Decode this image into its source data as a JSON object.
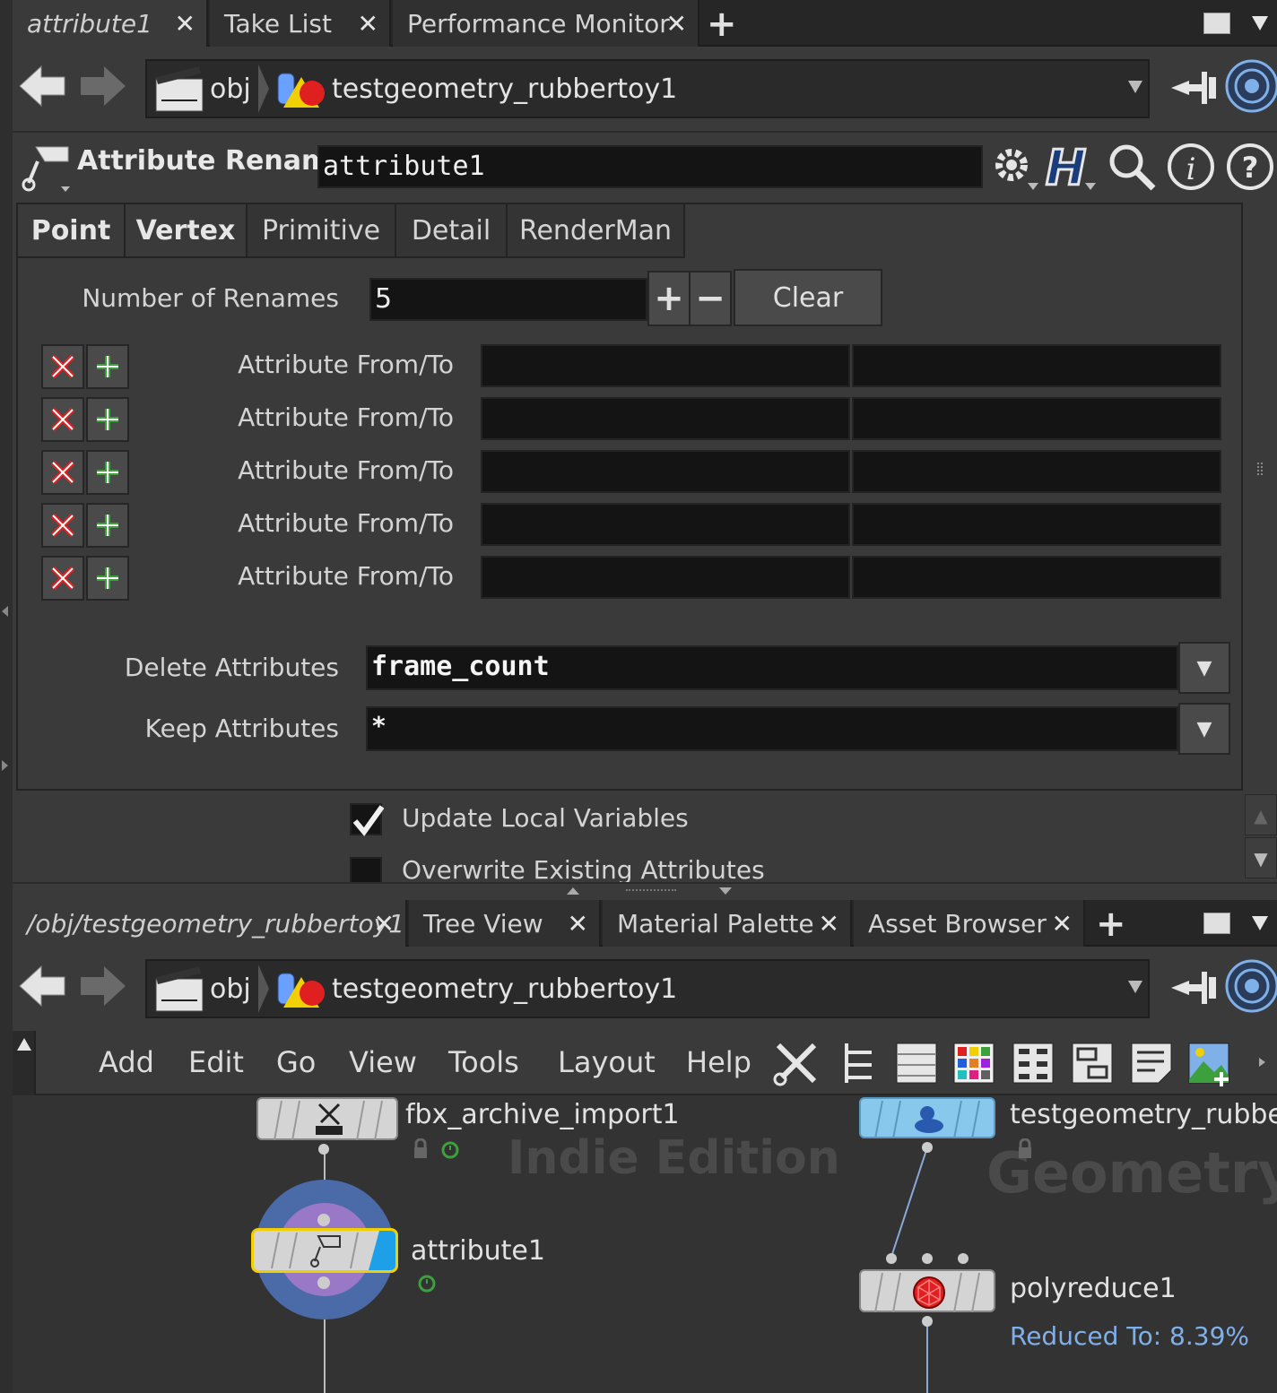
{
  "top_tabs": [
    {
      "label": "attribute1"
    },
    {
      "label": "Take List"
    },
    {
      "label": "Performance Monitor"
    }
  ],
  "top_path": {
    "root": "obj",
    "node": "testgeometry_rubbertoy1"
  },
  "param_header": {
    "node_type": "Attribute Rename",
    "node_name": "attribute1"
  },
  "param_tabs": [
    "Point",
    "Vertex",
    "Primitive",
    "Detail",
    "RenderMan"
  ],
  "params": {
    "num_renames_label": "Number of Renames",
    "num_renames_value": "5",
    "clear_label": "Clear",
    "rename_rows": [
      {
        "label": "Attribute From/To",
        "from": "",
        "to": ""
      },
      {
        "label": "Attribute From/To",
        "from": "",
        "to": ""
      },
      {
        "label": "Attribute From/To",
        "from": "",
        "to": ""
      },
      {
        "label": "Attribute From/To",
        "from": "",
        "to": ""
      },
      {
        "label": "Attribute From/To",
        "from": "",
        "to": ""
      }
    ],
    "delete_label": "Delete Attributes",
    "delete_value": "frame_count",
    "keep_label": "Keep Attributes",
    "keep_value": "*",
    "update_local_label": "Update Local Variables",
    "update_local_checked": true,
    "overwrite_label": "Overwrite Existing Attributes",
    "overwrite_checked": false
  },
  "bottom_tabs": [
    {
      "label": "/obj/testgeometry_rubbertoy1"
    },
    {
      "label": "Tree View"
    },
    {
      "label": "Material Palette"
    },
    {
      "label": "Asset Browser"
    }
  ],
  "bottom_path": {
    "root": "obj",
    "node": "testgeometry_rubbertoy1"
  },
  "net_menu": [
    "Add",
    "Edit",
    "Go",
    "View",
    "Tools",
    "Layout",
    "Help"
  ],
  "network": {
    "watermark_edition": "Indie Edition",
    "watermark_context": "Geometry",
    "nodes": {
      "fbx": "fbx_archive_import1",
      "attribute": "attribute1",
      "testgeo": "testgeometry_rubber",
      "polyreduce": "polyreduce1",
      "polyreduce_info": "Reduced To: 8.39%"
    }
  },
  "colors": {
    "accent_blue": "#7fb0e8",
    "delete_red": "#e02020",
    "add_green": "#3ca03c",
    "node_yellow": "#f0d000"
  }
}
